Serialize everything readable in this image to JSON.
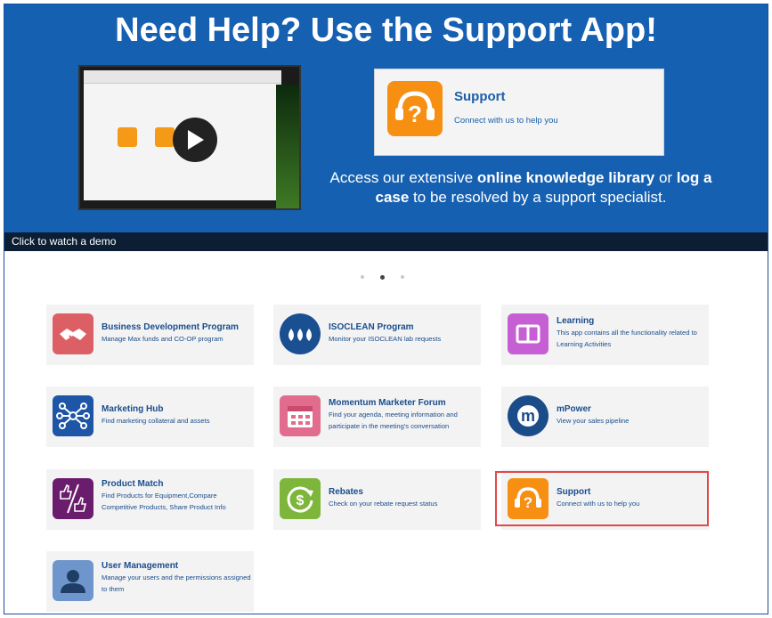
{
  "banner": {
    "title": "Need Help? Use the Support App!",
    "support_card": {
      "title": "Support",
      "description": "Connect with us to help you",
      "icon": "headset-question-icon"
    },
    "text": {
      "part1": "Access our extensive ",
      "bold1": "online knowledge library",
      "part2": " or ",
      "bold2": "log a case",
      "part3": " to be resolved by a support specialist."
    },
    "video": {
      "play_icon": "play-icon"
    }
  },
  "caption": "Click to watch a demo",
  "carousel": {
    "page_count": 3,
    "active_page": 2
  },
  "apps": [
    {
      "title": "Business Development Program",
      "description": "Manage Max funds and CO-OP program",
      "icon": "handshake-icon",
      "color": "#dd5f66"
    },
    {
      "title": "ISOCLEAN Program",
      "description": "Monitor your ISOCLEAN lab requests",
      "icon": "water-drops-icon",
      "color": "#1a4f92"
    },
    {
      "title": "Learning",
      "description": "This app contains all the functionality related to Learning Activities",
      "icon": "book-icon",
      "color": "#c55fd3"
    },
    {
      "title": "Marketing Hub",
      "description": "Find marketing collateral and assets",
      "icon": "network-icon",
      "color": "#1e55a6"
    },
    {
      "title": "Momentum Marketer Forum",
      "description": "Find your agenda, meeting information and participate in the meeting's conversation",
      "icon": "calendar-icon",
      "color": "#e26c8d"
    },
    {
      "title": "mPower",
      "description": "View your sales pipeline",
      "icon": "mpower-logo-icon",
      "color": "#1a4c8a"
    },
    {
      "title": "Product Match",
      "description": "Find Products for Equipment,Compare Competitive Products, Share Product Info",
      "icon": "thumbs-compare-icon",
      "color": "#6a1d6c"
    },
    {
      "title": "Rebates",
      "description": "Check on your rebate request status",
      "icon": "dollar-refresh-icon",
      "color": "#7db63a"
    },
    {
      "title": "Support",
      "description": "Connect with us to help you",
      "icon": "headset-question-icon",
      "color": "#f68f12"
    },
    {
      "title": "User Management",
      "description": "Manage your users and the permissions assigned to them",
      "icon": "user-icon",
      "color": "#6e96cc"
    }
  ]
}
